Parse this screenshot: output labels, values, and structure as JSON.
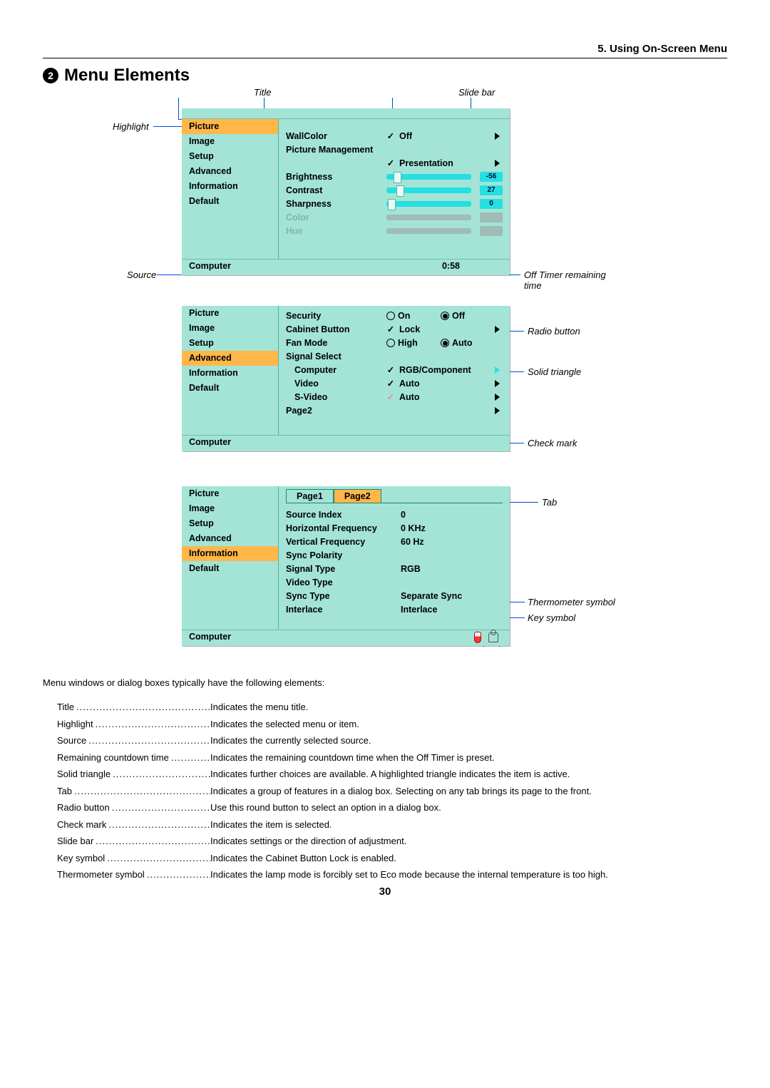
{
  "header": {
    "section": "5. Using On-Screen Menu",
    "bullet_num": "2",
    "title": "Menu Elements"
  },
  "callouts": {
    "title": "Title",
    "slide_bar": "Slide bar",
    "highlight": "Highlight",
    "source": "Source",
    "off_timer": "Off Timer remaining time",
    "radio_button": "Radio button",
    "solid_triangle": "Solid triangle",
    "check_mark": "Check mark",
    "tab": "Tab",
    "thermometer": "Thermometer symbol",
    "key_symbol": "Key symbol"
  },
  "panel1": {
    "left": [
      "Picture",
      "Image",
      "Setup",
      "Advanced",
      "Information",
      "Default"
    ],
    "highlight_index": 0,
    "wallcolor_lbl": "WallColor",
    "wallcolor_val": "Off",
    "picmgmt_lbl": "Picture Management",
    "picmgmt_val": "Presentation",
    "brightness_lbl": "Brightness",
    "brightness_val": "-56",
    "contrast_lbl": "Contrast",
    "contrast_val": "27",
    "sharpness_lbl": "Sharpness",
    "sharpness_val": "0",
    "color_lbl": "Color",
    "hue_lbl": "Hue",
    "source": "Computer",
    "timer": "0:58"
  },
  "panel2": {
    "left": [
      "Picture",
      "Image",
      "Setup",
      "Advanced",
      "Information",
      "Default"
    ],
    "highlight_index": 3,
    "security_lbl": "Security",
    "on": "On",
    "off": "Off",
    "cabinet_lbl": "Cabinet Button",
    "cabinet_val": "Lock",
    "fan_lbl": "Fan Mode",
    "high": "High",
    "auto": "Auto",
    "signal_lbl": "Signal Select",
    "computer_lbl": "Computer",
    "computer_val": "RGB/Component",
    "video_lbl": "Video",
    "video_val": "Auto",
    "svideo_lbl": "S-Video",
    "svideo_val": "Auto",
    "page2_lbl": "Page2",
    "source": "Computer"
  },
  "panel3": {
    "left": [
      "Picture",
      "Image",
      "Setup",
      "Advanced",
      "Information",
      "Default"
    ],
    "highlight_index": 4,
    "tab1": "Page1",
    "tab2": "Page2",
    "rows": [
      {
        "lbl": "Source Index",
        "val": "0"
      },
      {
        "lbl": "Horizontal Frequency",
        "val": "0 KHz"
      },
      {
        "lbl": "Vertical Frequency",
        "val": "60 Hz"
      },
      {
        "lbl": "Sync Polarity",
        "val": ""
      },
      {
        "lbl": "Signal Type",
        "val": "RGB"
      },
      {
        "lbl": "Video Type",
        "val": ""
      },
      {
        "lbl": "Sync Type",
        "val": "Separate Sync"
      },
      {
        "lbl": "Interlace",
        "val": "Interlace"
      }
    ],
    "source": "Computer"
  },
  "desc": {
    "intro": "Menu windows or dialog boxes typically have the following elements:",
    "items": [
      {
        "term": "Title",
        "def": "Indicates the menu title."
      },
      {
        "term": "Highlight",
        "def": "Indicates the selected menu or item."
      },
      {
        "term": "Source",
        "def": "Indicates the currently selected source."
      },
      {
        "term": "Remaining countdown time",
        "def": "Indicates the remaining countdown time when the Off Timer is preset."
      },
      {
        "term": "Solid triangle",
        "def": "Indicates further choices are available. A highlighted triangle indicates the item is active."
      },
      {
        "term": "Tab",
        "def": "Indicates a group of features in a dialog box. Selecting on any tab brings its page to the front."
      },
      {
        "term": "Radio button",
        "def": "Use this round button to select an option in a dialog box."
      },
      {
        "term": "Check mark",
        "def": "Indicates the item is selected."
      },
      {
        "term": "Slide bar",
        "def": "Indicates settings or the direction of adjustment."
      },
      {
        "term": "Key symbol",
        "def": "Indicates the Cabinet Button Lock is enabled."
      },
      {
        "term": "Thermometer symbol",
        "def": "Indicates the lamp mode is forcibly set to Eco mode because the internal temperature is too high."
      }
    ]
  },
  "page_number": "30"
}
